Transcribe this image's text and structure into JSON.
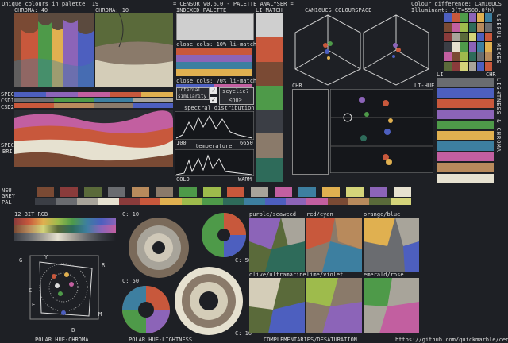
{
  "header": {
    "unique": "Unique colours in palette: 19",
    "title": "= CENSOR v0.6.0 - PALETTE ANALYSER =",
    "diff": "Colour difference: CAM16UCS",
    "illum": "Illuminant: D(T=5500.0°K)"
  },
  "labels": {
    "chroma40": "CHROMA: 40",
    "chroma10": "CHROMA: 10",
    "indexed": "INDEXED PALETTE",
    "limatch": "LI-MATCH",
    "cam16": "CAM16UCS COLOURSPACE",
    "spec_a": "SPEC",
    "csd1": "CSD1",
    "csd2": "CSD2",
    "spec_b": "SPEC",
    "bri": "BRI",
    "neu": "NEU",
    "grey": "GREY",
    "pal": "PAL",
    "chr_left": "CHR",
    "lihue": "LI-HUE",
    "li": "LI",
    "chr_right": "CHR",
    "close1": "close cols: 10% li-match",
    "close2": "close cols: 70% li-match",
    "internal": "internal similarity",
    "cyclic": "scyclic?",
    "no": "<no>",
    "spectral": "spectral distribution",
    "s100": "100",
    "s6650": "6650",
    "temperature": "temperature",
    "cold": "COLD",
    "warm": "WARM",
    "rgb12": "12 BIT RGB",
    "c10a": "C: 10",
    "c50a": "C: 50",
    "c50b": "C: 50",
    "c10b": "C: 10",
    "purple": "purple/seaweed",
    "redcyan": "red/cyan",
    "orangeblue": "orange/blue",
    "olive": "olive/ultramarine",
    "limeviolet": "lime/violet",
    "emerald": "emerald/rose",
    "polar_hc": "POLAR HUE-CHROMA",
    "polar_hl": "POLAR HUE-LIGHTNESS",
    "compl": "COMPLEMENTARIES/DESATURATION",
    "url": "https://github.com/quickmarble/censor",
    "useful": "USEFUL MIXES",
    "lightness": "LIGHTNESS & CHROMA",
    "wheel": {
      "G": "G",
      "Y": "Y",
      "R": "R",
      "C": "C",
      "M": "M",
      "B": "B",
      "E": "E"
    }
  },
  "palette": [
    "#1e2025",
    "#3b3e45",
    "#6a6c70",
    "#a8a49a",
    "#e6e1d0",
    "#8a3b3b",
    "#c8583c",
    "#e0b050",
    "#9ebb4c",
    "#4e9a49",
    "#2e6b5a",
    "#3d7fa0",
    "#4d5fbf",
    "#8c64b8",
    "#c25fa0",
    "#7a4a34",
    "#b88a5c",
    "#5a6a3a",
    "#d4d47a"
  ],
  "colors": {
    "accent": "#dcdcdc",
    "frame": "#888888"
  }
}
